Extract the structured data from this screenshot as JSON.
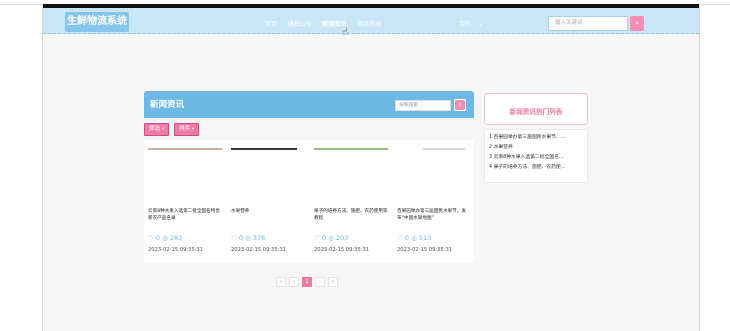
{
  "header": {
    "logo": "生鲜物流系统",
    "nav": [
      "首页",
      "通知公告",
      "新闻资讯",
      "商品信息"
    ],
    "mine": "我的",
    "search_placeholder": "输入关键词"
  },
  "news": {
    "title": "新闻资讯",
    "search_placeholder": "按照搜索",
    "filter_label": "筛选",
    "sort_label": "排序",
    "cards": [
      {
        "title": "云南8种水果入选第二批全国名特优新农产品名录",
        "likes": "0",
        "views": "283",
        "date": "2023-02-15 09:35:31",
        "strip_color": "#c7b3a3",
        "strip_width": 74
      },
      {
        "title": "水果营养",
        "likes": "0",
        "views": "376",
        "date": "2023-02-15 09:35:31",
        "strip_color": "#3a3a3a",
        "strip_width": 66
      },
      {
        "title": "果子的培养方法、施肥、农药使用等教程",
        "likes": "0",
        "views": "203",
        "date": "2023-02-15 09:35:31",
        "strip_color": "#9bbf7a",
        "strip_width": 74
      },
      {
        "title": "百果园举办第三届国民水果节，发布“中国水果地图”",
        "likes": "0",
        "views": "513",
        "date": "2023-02-15 09:35:31",
        "strip_color": "#d8d8d8",
        "strip_width": 42
      }
    ]
  },
  "hot": {
    "title": "新闻资讯热门列表",
    "items": [
      "1  百果园举办第三届国民水果节、...",
      "2  水果营养",
      "3  云南8种水果入选第二批全国名...",
      "4  果子的培养方法、施肥、农药使..."
    ]
  },
  "pagination": [
    "«",
    "‹",
    "1",
    "›",
    "»"
  ],
  "colors": {
    "accent_blue": "#6cb9e4",
    "accent_pink": "#ee7aa6",
    "header_bg": "#c9e6f6"
  }
}
